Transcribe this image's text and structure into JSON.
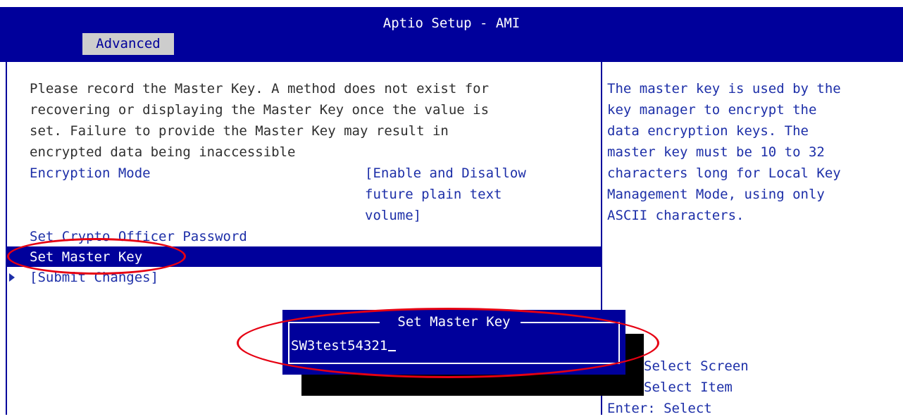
{
  "header": {
    "title": "Aptio Setup - AMI",
    "tab": "Advanced"
  },
  "main": {
    "description": [
      "Please record the Master Key. A method does not exist for",
      "recovering or displaying the Master Key once the value is",
      "set. Failure to provide the Master Key may result in",
      "encrypted data being inaccessible"
    ],
    "encryption_mode_label": "Encryption Mode",
    "encryption_mode_value": [
      "[Enable and Disallow",
      "future plain text",
      "volume]"
    ],
    "crypto_officer_label": "Set Crypto Officer Password",
    "master_key_label": "Set Master Key",
    "submit_label": "[Submit Changes]"
  },
  "help": {
    "lines": [
      "The master key is used by the",
      "key manager to encrypt the",
      "data encryption keys. The",
      "master key must be 10 to 32",
      "characters long for Local Key",
      "Management Mode, using only",
      "ASCII characters."
    ]
  },
  "keys": [
    "Select Screen",
    "Select Item",
    "Enter: Select"
  ],
  "dialog": {
    "title": "Set Master Key",
    "value": "SW3test54321"
  },
  "colors": {
    "bios_blue": "#00009b",
    "text_blue": "#1d2fa8",
    "highlight_red": "#e60012",
    "tab_gray": "#cdcdcd"
  }
}
